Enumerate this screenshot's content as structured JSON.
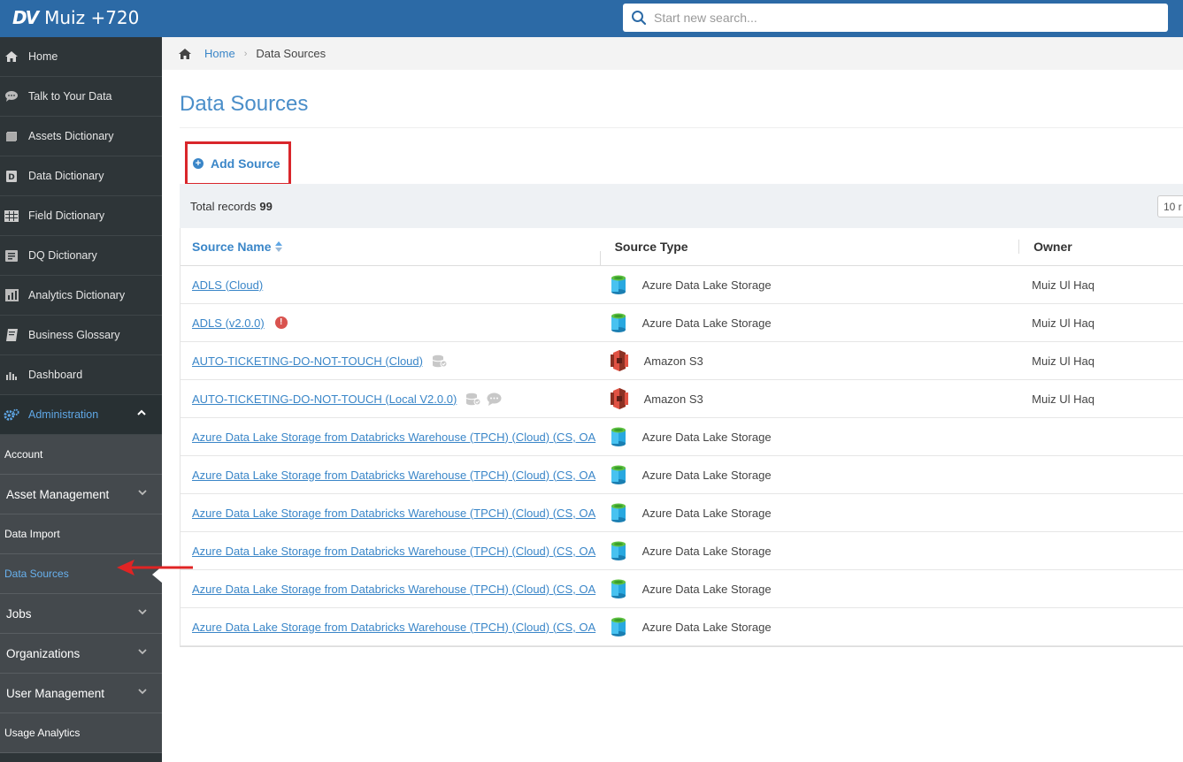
{
  "app": {
    "logo_mark": "DV",
    "title": "Muiz +720"
  },
  "search": {
    "placeholder": "Start new search..."
  },
  "sidebar": {
    "items": [
      {
        "label": "Home",
        "icon": "home-icon"
      },
      {
        "label": "Talk to Your Data",
        "icon": "chat-icon"
      },
      {
        "label": "Assets Dictionary",
        "icon": "assets-icon"
      },
      {
        "label": "Data Dictionary",
        "icon": "data-dictionary-icon"
      },
      {
        "label": "Field Dictionary",
        "icon": "field-icon"
      },
      {
        "label": "DQ Dictionary",
        "icon": "dq-icon"
      },
      {
        "label": "Analytics Dictionary",
        "icon": "analytics-icon"
      },
      {
        "label": "Business Glossary",
        "icon": "book-icon"
      },
      {
        "label": "Dashboard",
        "icon": "bar-chart-icon"
      }
    ],
    "admin": {
      "label": "Administration",
      "icon": "gears-icon"
    },
    "sub_items": [
      {
        "label": "Account"
      },
      {
        "label": "Asset Management"
      },
      {
        "label": "Data Import"
      },
      {
        "label": "Data Sources"
      },
      {
        "label": "Jobs"
      },
      {
        "label": "Organizations"
      },
      {
        "label": "User Management"
      },
      {
        "label": "Usage Analytics"
      }
    ]
  },
  "breadcrumb": {
    "home": "Home",
    "current": "Data Sources"
  },
  "page": {
    "title": "Data Sources",
    "add_source": "Add Source",
    "total_records_label": "Total records",
    "total_records_value": "99",
    "page_size": "10 r"
  },
  "table": {
    "headers": {
      "source_name": "Source Name",
      "source_type": "Source Type",
      "owner": "Owner"
    },
    "rows": [
      {
        "name": "ADLS (Cloud)",
        "type": "Azure Data Lake Storage",
        "owner": "Muiz Ul Haq"
      },
      {
        "name": "ADLS (v2.0.0)",
        "type": "Azure Data Lake Storage",
        "owner": "Muiz Ul Haq"
      },
      {
        "name": "AUTO-TICKETING-DO-NOT-TOUCH (Cloud)",
        "type": "Amazon S3",
        "owner": "Muiz Ul Haq"
      },
      {
        "name": "AUTO-TICKETING-DO-NOT-TOUCH (Local V2.0.0)",
        "type": "Amazon S3",
        "owner": "Muiz Ul Haq"
      },
      {
        "name": "Azure Data Lake Storage from Databricks Warehouse (TPCH) (Cloud) (CS, OA",
        "type": "Azure Data Lake Storage",
        "owner": ""
      },
      {
        "name": "Azure Data Lake Storage from Databricks Warehouse (TPCH) (Cloud) (CS, OA",
        "type": "Azure Data Lake Storage",
        "owner": ""
      },
      {
        "name": "Azure Data Lake Storage from Databricks Warehouse (TPCH) (Cloud) (CS, OA",
        "type": "Azure Data Lake Storage",
        "owner": ""
      },
      {
        "name": "Azure Data Lake Storage from Databricks Warehouse (TPCH) (Cloud) (CS, OA",
        "type": "Azure Data Lake Storage",
        "owner": ""
      },
      {
        "name": "Azure Data Lake Storage from Databricks Warehouse (TPCH) (Cloud) (CS, OA",
        "type": "Azure Data Lake Storage",
        "owner": ""
      },
      {
        "name": "Azure Data Lake Storage from Databricks Warehouse (TPCH) (Cloud) (CS, OA",
        "type": "Azure Data Lake Storage",
        "owner": ""
      }
    ]
  },
  "colors": {
    "topbar": "#2c6aa6",
    "sidebar": "#2e3538",
    "accent": "#3a86c8",
    "highlight_box": "#d9262b",
    "warning": "#d9534f"
  }
}
